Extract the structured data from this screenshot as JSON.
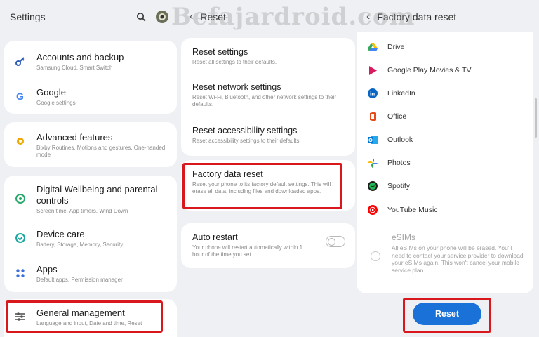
{
  "watermark": "Befajardroid.com",
  "settings": {
    "title": "Settings",
    "items": [
      {
        "label": "Accounts and backup",
        "sub": "Samsung Cloud, Smart Switch"
      },
      {
        "label": "Google",
        "sub": "Google settings"
      },
      {
        "label": "Advanced features",
        "sub": "Bixby Routines, Motions and gestures, One-handed mode"
      },
      {
        "label": "Digital Wellbeing and parental controls",
        "sub": "Screen time, App timers, Wind Down"
      },
      {
        "label": "Device care",
        "sub": "Battery, Storage, Memory, Security"
      },
      {
        "label": "Apps",
        "sub": "Default apps, Permission manager"
      },
      {
        "label": "General management",
        "sub": "Language and input, Date and time, Reset"
      }
    ]
  },
  "reset": {
    "title": "Reset",
    "items": [
      {
        "label": "Reset settings",
        "sub": "Reset all settings to their defaults."
      },
      {
        "label": "Reset network settings",
        "sub": "Reset Wi-Fi, Bluetooth, and other network settings to their defaults."
      },
      {
        "label": "Reset accessibility settings",
        "sub": "Reset accessibility settings to their defaults."
      },
      {
        "label": "Factory data reset",
        "sub": "Reset your phone to its factory default settings. This will erase all data, including files and downloaded apps."
      },
      {
        "label": "Auto restart",
        "sub": "Your phone will restart automatically within 1 hour of the time you set."
      }
    ]
  },
  "factory": {
    "title": "Factory data reset",
    "apps": [
      "Drive",
      "Google Play Movies & TV",
      "LinkedIn",
      "Office",
      "Outlook",
      "Photos",
      "Spotify",
      "YouTube Music"
    ],
    "esims_label": "eSIMs",
    "esims_sub": "All eSIMs on your phone will be erased. You'll need to contact your service provider to download your eSIMs again. This won't cancel your mobile service plan.",
    "reset_button": "Reset"
  },
  "colors": {
    "highlight": "#d9181e",
    "accent": "#1a72d8"
  }
}
